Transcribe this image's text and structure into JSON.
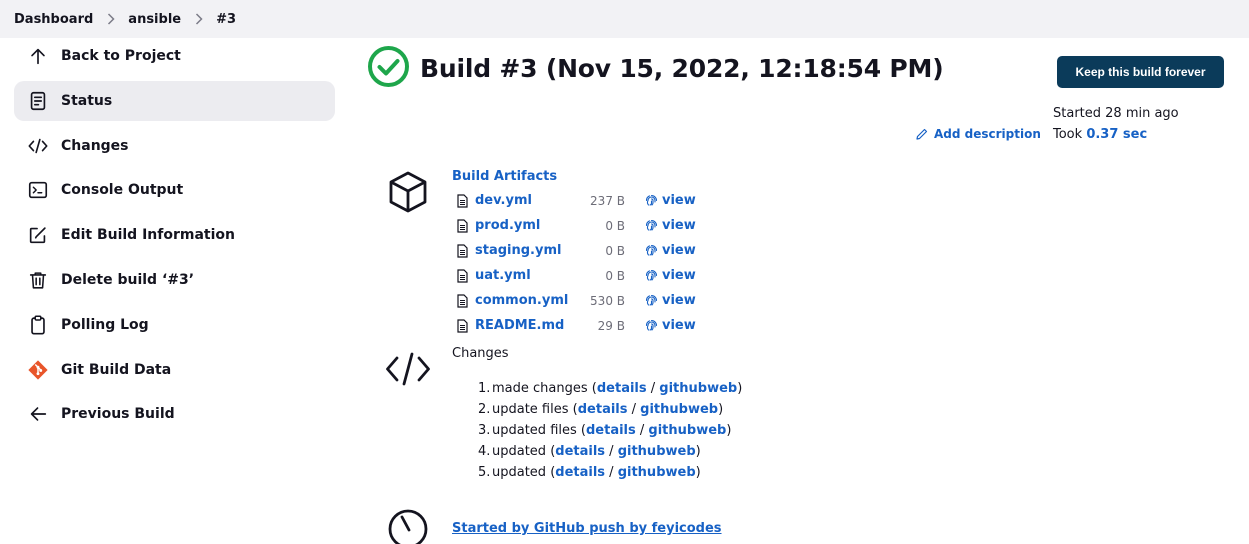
{
  "breadcrumb": [
    "Dashboard",
    "ansible",
    "#3"
  ],
  "sidebar": {
    "items": [
      {
        "label": "Back to Project",
        "icon": "arrow-up-icon"
      },
      {
        "label": "Status",
        "icon": "document-icon"
      },
      {
        "label": "Changes",
        "icon": "code-icon"
      },
      {
        "label": "Console Output",
        "icon": "terminal-icon"
      },
      {
        "label": "Edit Build Information",
        "icon": "edit-icon"
      },
      {
        "label": "Delete build ‘#3’",
        "icon": "trash-icon"
      },
      {
        "label": "Polling Log",
        "icon": "clipboard-icon"
      },
      {
        "label": "Git Build Data",
        "icon": "git-icon"
      },
      {
        "label": "Previous Build",
        "icon": "arrow-left-icon"
      }
    ]
  },
  "build": {
    "title": "Build #3 (Nov 15, 2022, 12:18:54 PM)",
    "status_icon": "success-check-icon",
    "status_color": "#1ea64b"
  },
  "actions": {
    "keep_label": "Keep this build forever",
    "add_description": "Add description"
  },
  "meta": {
    "started": "Started 28 min ago",
    "took_prefix": "Took ",
    "took_value": "0.37 sec"
  },
  "artifacts": {
    "header": "Build Artifacts",
    "view_label": "view",
    "files": [
      {
        "name": "dev.yml",
        "size": "237 B"
      },
      {
        "name": "prod.yml",
        "size": "0 B"
      },
      {
        "name": "staging.yml",
        "size": "0 B"
      },
      {
        "name": "uat.yml",
        "size": "0 B"
      },
      {
        "name": "common.yml",
        "size": "530 B"
      },
      {
        "name": "README.md",
        "size": "29 B"
      }
    ]
  },
  "changes": {
    "header": "Changes",
    "details_label": "details",
    "web_label": "githubweb",
    "entries": [
      {
        "num": "1.",
        "text": "made changes"
      },
      {
        "num": "2.",
        "text": "update files"
      },
      {
        "num": "3.",
        "text": "updated files"
      },
      {
        "num": "4.",
        "text": "updated"
      },
      {
        "num": "5.",
        "text": "updated"
      }
    ]
  },
  "cause": {
    "text": "Started by GitHub push by feyicodes"
  },
  "colors": {
    "link": "#1761c5",
    "button_bg": "#0b3b5a",
    "topbar_bg": "#f2f2f5",
    "active_bg": "#ececf0",
    "git_icon": "#e8552a"
  }
}
